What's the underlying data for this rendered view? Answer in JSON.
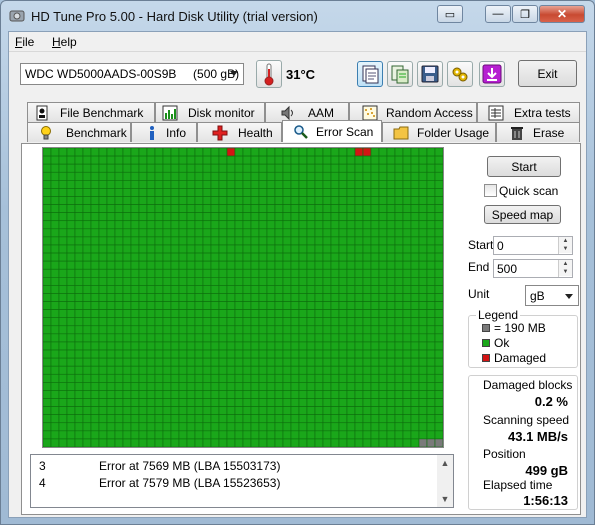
{
  "window": {
    "title": "HD Tune Pro 5.00 - Hard Disk Utility (trial version)",
    "controls": {
      "minimize": "—",
      "restore": "❐",
      "close": "✕",
      "extra": "▭"
    }
  },
  "menu": [
    {
      "label": "File",
      "accel": "F",
      "rest": "ile"
    },
    {
      "label": "Help",
      "accel": "H",
      "rest": "elp"
    }
  ],
  "toolbar": {
    "drive": "WDC WD5000AADS-00S9B     (500 gB)",
    "temperature": "31°C",
    "exit_label": "Exit"
  },
  "tabs_top": [
    {
      "label": "File Benchmark",
      "icon": "file-benchmark-icon"
    },
    {
      "label": "Disk monitor",
      "icon": "disk-monitor-icon"
    },
    {
      "label": "AAM",
      "icon": "speaker-icon"
    },
    {
      "label": "Random Access",
      "icon": "random-access-icon"
    },
    {
      "label": "Extra tests",
      "icon": "extra-tests-icon"
    }
  ],
  "tabs_bottom": [
    {
      "label": "Benchmark",
      "icon": "lightbulb-icon"
    },
    {
      "label": "Info",
      "icon": "info-icon"
    },
    {
      "label": "Health",
      "icon": "health-cross-icon"
    },
    {
      "label": "Error Scan",
      "icon": "magnifier-icon",
      "active": true
    },
    {
      "label": "Folder Usage",
      "icon": "folder-icon"
    },
    {
      "label": "Erase",
      "icon": "trash-icon"
    }
  ],
  "scan_grid": {
    "cols": 50,
    "rows": 37,
    "ok_color": "#1aa71a",
    "damaged_color": "#d31414",
    "unscanned_color": "#7a7a7a",
    "damaged_blocks": [
      [
        0,
        23
      ],
      [
        0,
        39
      ],
      [
        0,
        40
      ]
    ],
    "unscanned_blocks": [
      [
        36,
        47
      ],
      [
        36,
        48
      ],
      [
        36,
        49
      ]
    ]
  },
  "log": {
    "rows": [
      {
        "num": "3",
        "text": "Error at 7569 MB (LBA 15503173)"
      },
      {
        "num": "4",
        "text": "Error at 7579 MB (LBA 15523653)"
      }
    ]
  },
  "controls": {
    "start_button": "Start",
    "quick_scan_label": "Quick scan",
    "speed_map_button": "Speed map",
    "start_label": "Start",
    "start_value": "0",
    "end_label": "End",
    "end_value": "500",
    "unit_label": "Unit",
    "unit_value": "gB"
  },
  "legend": {
    "title": "Legend",
    "items": [
      {
        "label": "= 190 MB",
        "color": "#7a7a7a"
      },
      {
        "label": "Ok",
        "color": "#1aa71a"
      },
      {
        "label": "Damaged",
        "color": "#d31414"
      }
    ]
  },
  "stats": {
    "damaged_blocks_label": "Damaged blocks",
    "damaged_blocks_value": "0.2 %",
    "scanning_speed_label": "Scanning speed",
    "scanning_speed_value": "43.1 MB/s",
    "position_label": "Position",
    "position_value": "499 gB",
    "elapsed_label": "Elapsed time",
    "elapsed_value": "1:56:13"
  }
}
